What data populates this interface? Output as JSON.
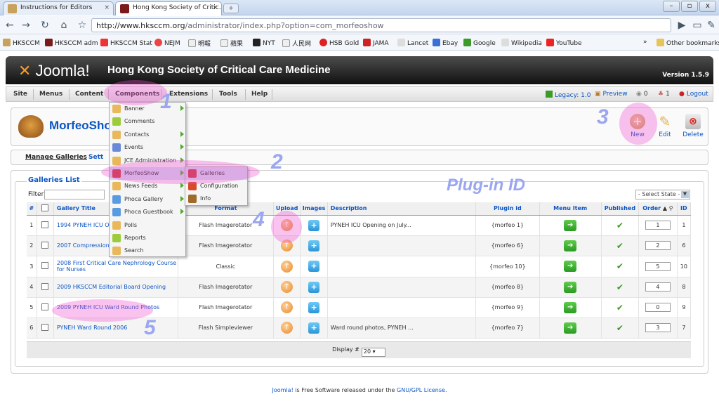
{
  "browser": {
    "tabs": [
      {
        "title": "Instructions for Editors",
        "active": false
      },
      {
        "title": "Hong Kong Society of Critic…",
        "active": true
      }
    ],
    "url_host": "http://www.hksccm.org",
    "url_path": "/administrator/index.php?option=com_morfeoshow",
    "bookmarks": [
      "HKSCCM",
      "HKSCCM adm",
      "HKSCCM Stat",
      "NEJM",
      "明報",
      "蘋果",
      "NYT",
      "人民网",
      "HSB Gold",
      "JAMA",
      "Lancet",
      "Ebay",
      "Google",
      "Wikipedia",
      "YouTube"
    ],
    "other_bookmarks": "Other bookmarks"
  },
  "header": {
    "logo": "Joomla!",
    "site_title": "Hong Kong Society of Critical Care Medicine",
    "version": "Version 1.5.9"
  },
  "menu": {
    "items": [
      "Site",
      "Menus",
      "Content",
      "Components",
      "Extensions",
      "Tools",
      "Help"
    ],
    "legacy": "Legacy: 1.0",
    "preview": "Preview",
    "messages": "0",
    "users": "1",
    "logout": "Logout"
  },
  "components_menu": [
    {
      "label": "Banner",
      "sub": true
    },
    {
      "label": "Comments",
      "sub": false
    },
    {
      "label": "Contacts",
      "sub": true
    },
    {
      "label": "Events",
      "sub": true
    },
    {
      "label": "JCE Administration",
      "sub": true
    },
    {
      "label": "MorfeoShow",
      "sub": true
    },
    {
      "label": "News Feeds",
      "sub": true
    },
    {
      "label": "Phoca Gallery",
      "sub": true
    },
    {
      "label": "Phoca Guestbook",
      "sub": true
    },
    {
      "label": "Polls",
      "sub": false
    },
    {
      "label": "Reports",
      "sub": false
    },
    {
      "label": "Search",
      "sub": false
    }
  ],
  "morfeo_submenu": [
    "Galleries",
    "Configuration",
    "Info"
  ],
  "toolbar": {
    "title": "MorfeoShow",
    "new": "New",
    "edit": "Edit",
    "delete": "Delete"
  },
  "submenu": {
    "manage": "Manage Galleries",
    "settings": "Sett"
  },
  "list": {
    "legend": "Galleries List",
    "filter_label": "Filter:",
    "state_select": "- Select State -",
    "annotation": "Plug-in ID",
    "columns": [
      "#",
      "",
      "Gallery Title",
      "Format",
      "Upload",
      "Images",
      "Description",
      "Plugin id",
      "Menu Item",
      "Published",
      "Order",
      "ID"
    ],
    "rows": [
      {
        "num": "1",
        "title": "1994 PYNEH ICU O",
        "format": "Flash Imagerotator",
        "desc": "PYNEH ICU Opening on July...",
        "plugin": "{morfeo 1}",
        "order": "1",
        "id": "1"
      },
      {
        "num": "2",
        "title": "2007 Compression",
        "format": "Flash Imagerotator",
        "desc": "",
        "plugin": "{morfeo 6}",
        "order": "2",
        "id": "6"
      },
      {
        "num": "3",
        "title": "2008 First Critical Care Nephrology Course for Nurses",
        "format": "Classic",
        "desc": "",
        "plugin": "{morfeo 10}",
        "order": "5",
        "id": "10"
      },
      {
        "num": "4",
        "title": "2009 HKSCCM Editorial Board Opening",
        "format": "Flash Imagerotator",
        "desc": "",
        "plugin": "{morfeo 8}",
        "order": "4",
        "id": "8"
      },
      {
        "num": "5",
        "title": "2009 PYNEH ICU Ward Round Photos",
        "format": "Flash Imagerotator",
        "desc": "",
        "plugin": "{morfeo 9}",
        "order": "0",
        "id": "9"
      },
      {
        "num": "6",
        "title": "PYNEH Ward Round 2006",
        "format": "Flash Simpleviewer",
        "desc": "Ward round photos, PYNEH ...",
        "plugin": "{morfeo 7}",
        "order": "3",
        "id": "7"
      }
    ],
    "display_label": "Display #",
    "display_value": "20"
  },
  "footer": {
    "joomla": "Joomla!",
    "text": " is Free Software released under the ",
    "license": "GNU/GPL License",
    "end": "."
  },
  "callouts": [
    "1",
    "2",
    "3",
    "4",
    "5"
  ]
}
